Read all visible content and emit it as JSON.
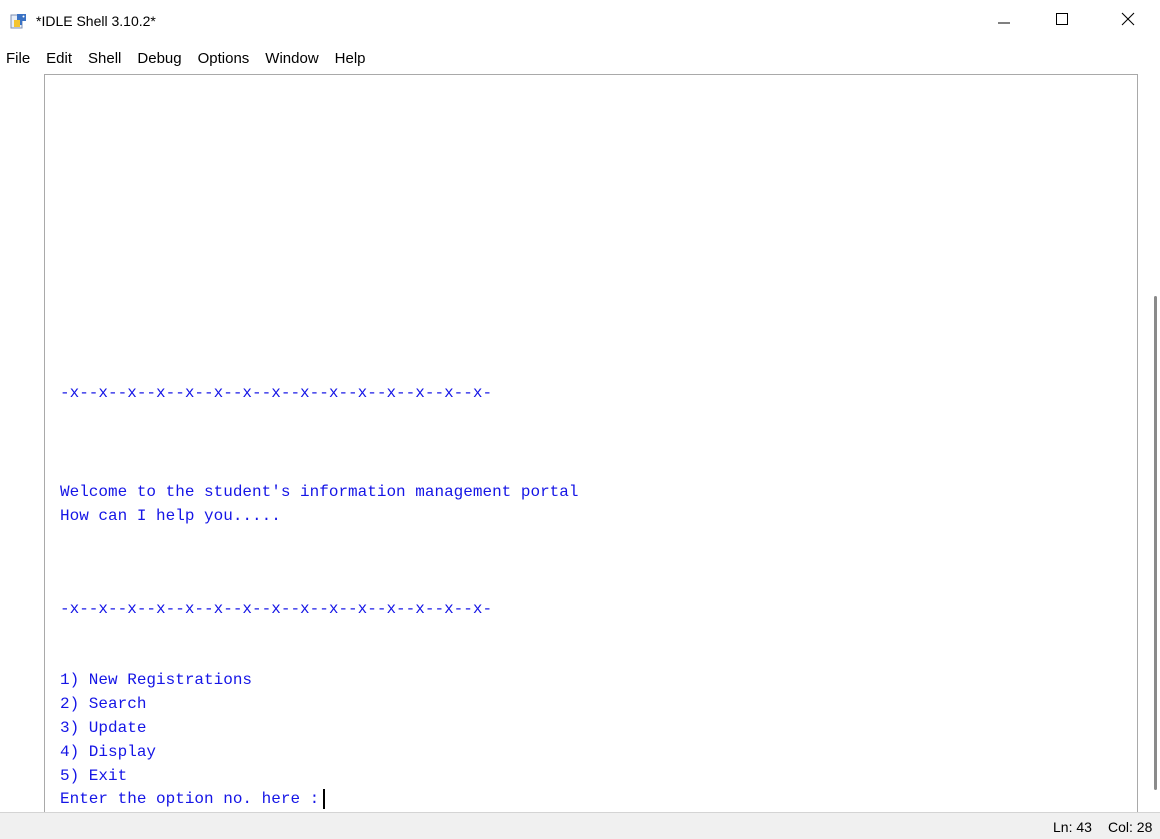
{
  "window": {
    "title": "*IDLE Shell 3.10.2*",
    "icon": "python-idle-icon"
  },
  "menu": {
    "items": [
      "File",
      "Edit",
      "Shell",
      "Debug",
      "Options",
      "Window",
      "Help"
    ]
  },
  "shell": {
    "separator_top": "-x--x--x--x--x--x--x--x--x--x--x--x--x--x--x-",
    "welcome": "Welcome to the student's information management portal",
    "help": "How can I help you.....",
    "separator_bottom": "-x--x--x--x--x--x--x--x--x--x--x--x--x--x--x-",
    "options": [
      "1) New Registrations",
      "2) Search",
      "3) Update",
      "4) Display",
      "5) Exit"
    ],
    "prompt": "Enter the option no. here :",
    "text_color": "#1515e6"
  },
  "status": {
    "line": "Ln: 43",
    "column": "Col: 28"
  }
}
